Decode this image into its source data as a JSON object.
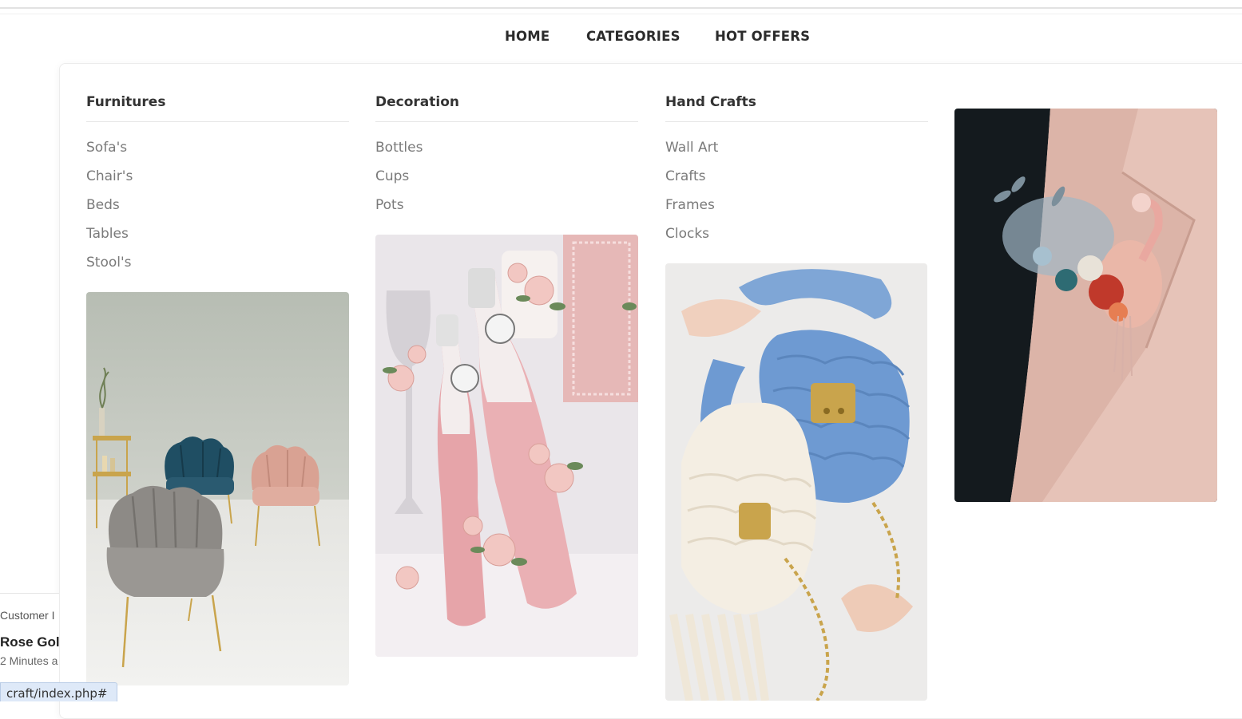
{
  "nav": {
    "home": "HOME",
    "categories": "CATEGORIES",
    "hot_offers": "HOT OFFERS"
  },
  "menu": {
    "columns": [
      {
        "title": "Furnitures",
        "items": [
          "Sofa's",
          "Chair's",
          "Beds",
          "Tables",
          "Stool's"
        ]
      },
      {
        "title": "Decoration",
        "items": [
          "Bottles",
          "Cups",
          "Pots"
        ]
      },
      {
        "title": "Hand Crafts",
        "items": [
          "Wall Art",
          "Crafts",
          "Frames",
          "Clocks"
        ]
      }
    ]
  },
  "toast": {
    "label": "Customer I",
    "product": "Rose Gol",
    "time": "2 Minutes a"
  },
  "status_url": "craft/index.php#",
  "colors": {
    "accent_pink": "#e9b7b2",
    "status_bg": "#dee9f8"
  }
}
